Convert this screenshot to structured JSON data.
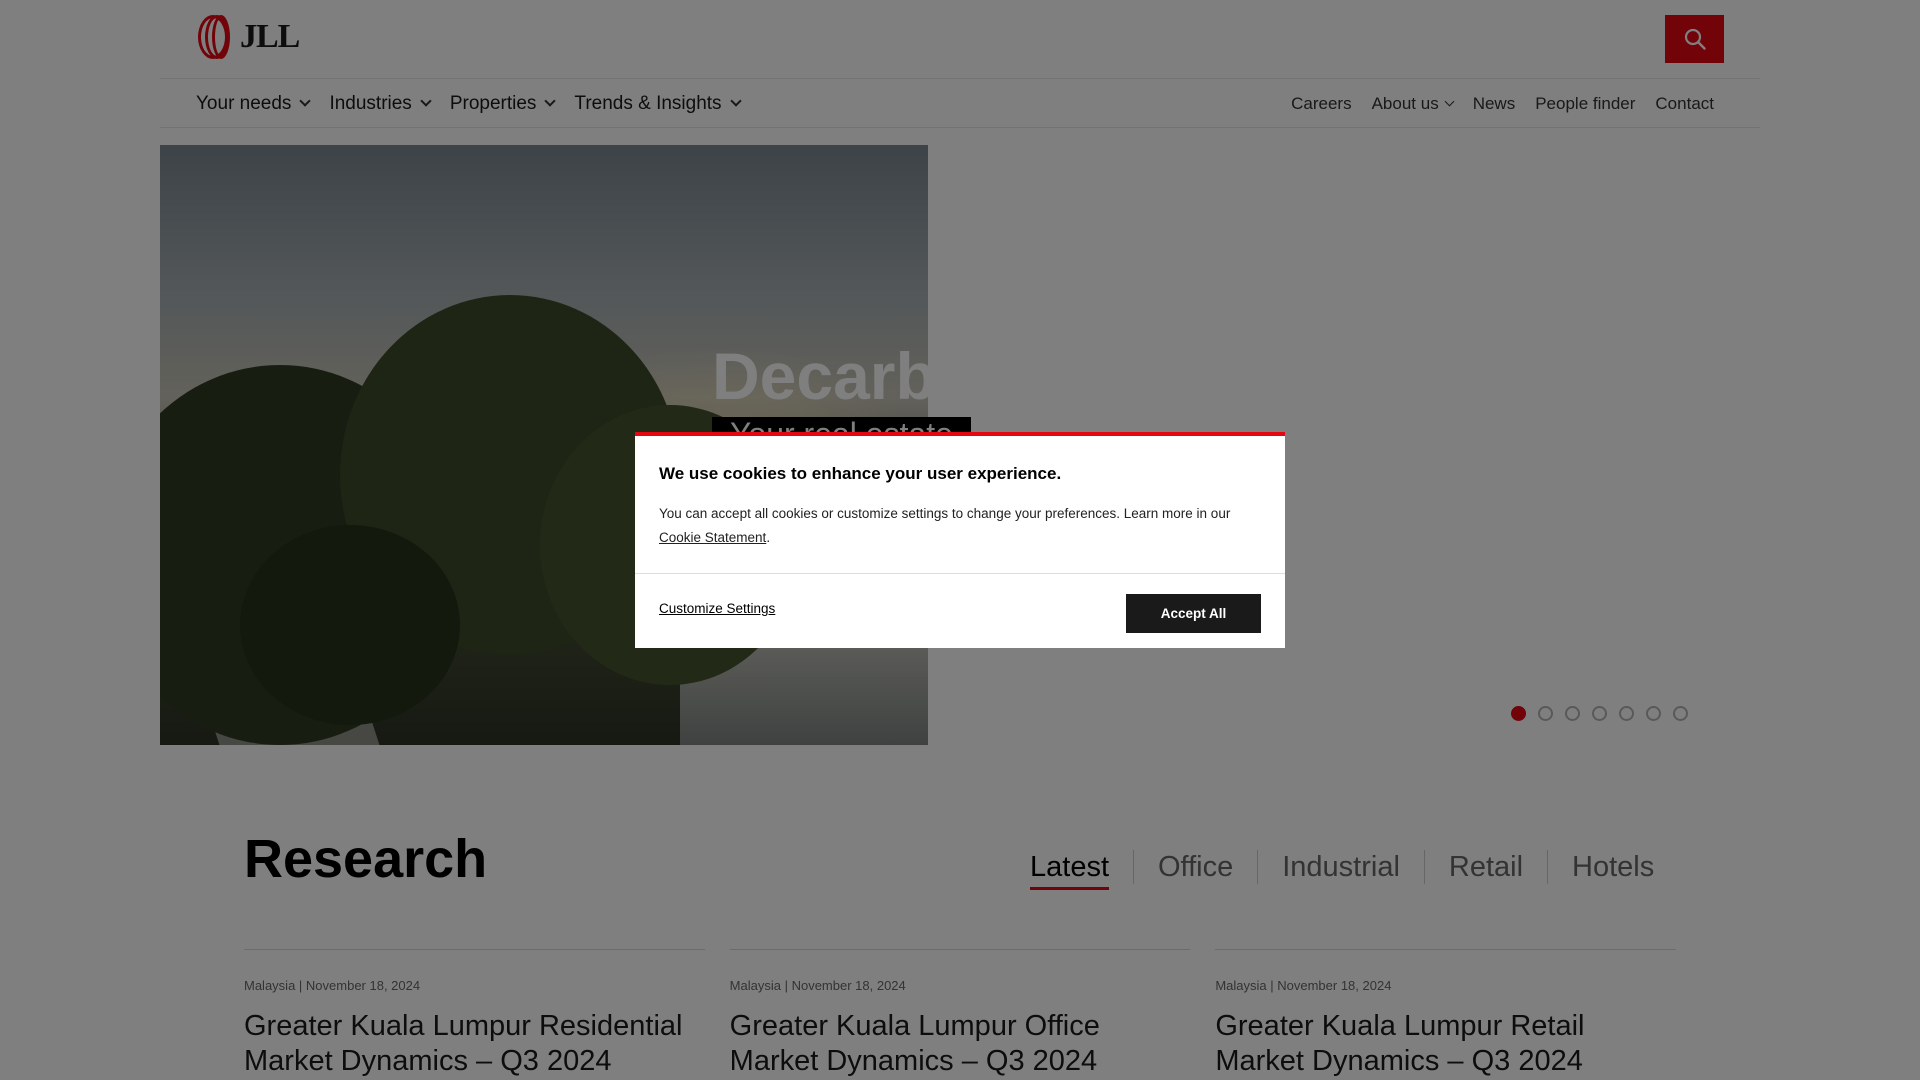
{
  "header": {
    "logo_text": "JLL",
    "search_icon": "search-icon",
    "brand_color": "#e30613"
  },
  "nav": {
    "primary": [
      "Your needs",
      "Industries",
      "Properties",
      "Trends & Insights"
    ],
    "secondary": [
      "Careers",
      "About us",
      "News",
      "People finder",
      "Contact"
    ]
  },
  "hero": {
    "title": "Decarb",
    "subtitle": "Your real estate",
    "carousel_slide_count": 7,
    "carousel_active_slide": 1
  },
  "research": {
    "title": "Research",
    "tabs": [
      "Latest",
      "Office",
      "Industrial",
      "Retail",
      "Hotels"
    ],
    "active_tab": "Latest",
    "cards": [
      {
        "country": "Malaysia",
        "date": "November 18, 2024",
        "title": "Greater Kuala Lumpur Residential Market Dynamics – Q3 2024"
      },
      {
        "country": "Malaysia",
        "date": "November 18, 2024",
        "title": "Greater Kuala Lumpur Office Market Dynamics – Q3 2024"
      },
      {
        "country": "Malaysia",
        "date": "November 18, 2024",
        "title": "Greater Kuala Lumpur Retail Market Dynamics – Q3 2024"
      }
    ]
  },
  "cookie_modal": {
    "title": "We use cookies to enhance your user experience.",
    "text": "You can accept all cookies or customize settings to change your preferences. Learn more in our ",
    "link_label": "Cookie Statement",
    "text_end": ".",
    "customize_label": "Customize Settings",
    "accept_label": "Accept All"
  }
}
